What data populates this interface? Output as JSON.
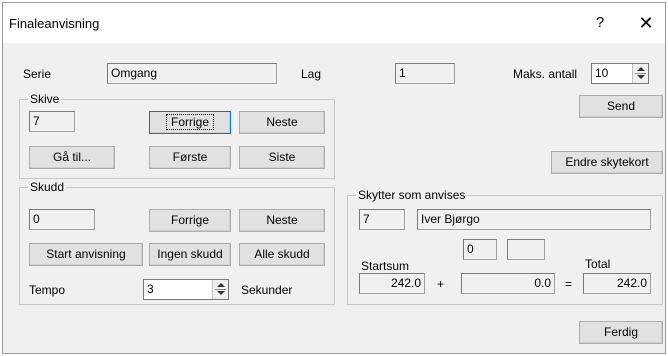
{
  "window": {
    "title": "Finaleanvisning",
    "help_glyph": "?",
    "close_glyph": "✕"
  },
  "top": {
    "serie_label": "Serie",
    "serie_value": "Omgang",
    "lag_label": "Lag",
    "lag_value": "1",
    "maks_label": "Maks. antall",
    "maks_value": "10"
  },
  "skive": {
    "title": "Skive",
    "value": "7",
    "forrige": "Forrige",
    "neste": "Neste",
    "ga_til": "Gå til...",
    "forste": "Første",
    "siste": "Siste"
  },
  "buttons": {
    "send": "Send",
    "endre": "Endre skytekort",
    "ferdig": "Ferdig"
  },
  "skudd": {
    "title": "Skudd",
    "value": "0",
    "forrige": "Forrige",
    "neste": "Neste",
    "start": "Start anvisning",
    "ingen": "Ingen skudd",
    "alle": "Alle skudd",
    "tempo_label": "Tempo",
    "tempo_value": "3",
    "sekunder": "Sekunder"
  },
  "skytter": {
    "title": "Skytter som anvises",
    "nr": "7",
    "navn": "Iver Bjørgo",
    "startsum_label": "Startsum",
    "startsum": "242.0",
    "plus": "+",
    "field_a": "0",
    "field_b": "",
    "add_value": "0.0",
    "equals": "=",
    "total_label": "Total",
    "total": "242.0"
  }
}
